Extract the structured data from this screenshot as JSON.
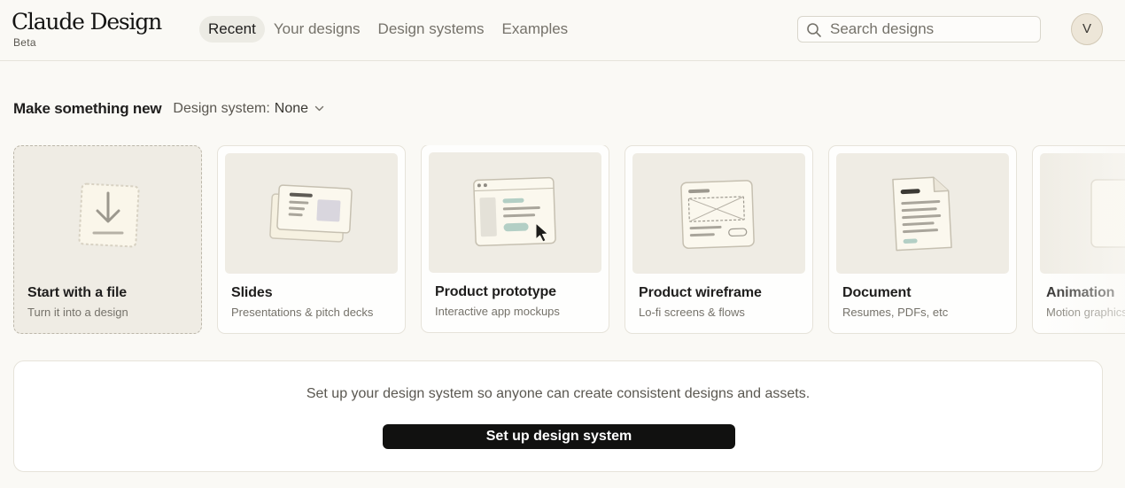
{
  "brand": {
    "name": "Claude Design",
    "badge": "Beta"
  },
  "nav": {
    "tabs": [
      {
        "label": "Recent",
        "active": true
      },
      {
        "label": "Your designs",
        "active": false
      },
      {
        "label": "Design systems",
        "active": false
      },
      {
        "label": "Examples",
        "active": false
      }
    ]
  },
  "search": {
    "placeholder": "Search designs",
    "value": "",
    "icon": "search-icon"
  },
  "user": {
    "avatar_initial": "V"
  },
  "section": {
    "title": "Make something new",
    "design_system_label": "Design system:",
    "design_system_value": "None"
  },
  "cards": [
    {
      "title": "Start with a file",
      "subtitle": "Turn it into a design",
      "icon": "download-icon"
    },
    {
      "title": "Slides",
      "subtitle": "Presentations & pitch decks",
      "icon": "slides-illustration"
    },
    {
      "title": "Product prototype",
      "subtitle": "Interactive app mockups",
      "icon": "prototype-illustration"
    },
    {
      "title": "Product wireframe",
      "subtitle": "Lo-fi screens & flows",
      "icon": "wireframe-illustration"
    },
    {
      "title": "Document",
      "subtitle": "Resumes, PDFs, etc",
      "icon": "document-illustration"
    },
    {
      "title": "Animation",
      "subtitle": "Motion graphics",
      "icon": "animation-illustration"
    }
  ],
  "banner": {
    "text": "Set up your design system so anyone can create consistent designs and assets.",
    "button_label": "Set up design system"
  },
  "colors": {
    "background": "#faf9f5",
    "thumb_bg": "#efece4",
    "accent_teal": "#b3cfc5",
    "button_bg": "#111110"
  }
}
